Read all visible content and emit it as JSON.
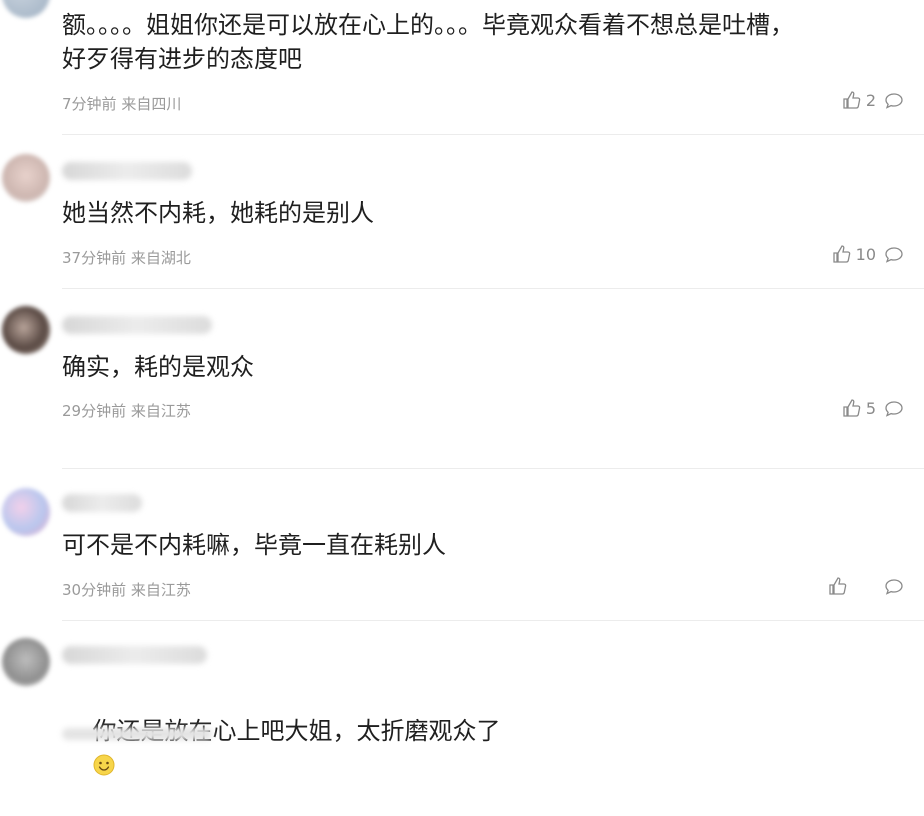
{
  "comments": [
    {
      "text": "额。。。。姐姐你还是可以放在心上的。。。毕竟观众看着不想总是吐槽，\n好歹得有进步的态度吧",
      "time": "7分钟前",
      "location": "来自四川",
      "likes": "2"
    },
    {
      "text": "她当然不内耗，她耗的是别人",
      "time": "37分钟前",
      "location": "来自湖北",
      "likes": "10"
    },
    {
      "text": "确实，耗的是观众",
      "time": "29分钟前",
      "location": "来自江苏",
      "likes": "5"
    },
    {
      "text": "可不是不内耗嘛，毕竟一直在耗别人",
      "time": "30分钟前",
      "location": "来自江苏",
      "likes": ""
    },
    {
      "text": "你还是放在心上吧大姐，太折磨观众了",
      "time": "",
      "location": "",
      "likes": ""
    }
  ],
  "icons": {
    "like": "thumbs-up-icon",
    "reply": "comment-bubble-icon",
    "emoji": "smile-emoji-icon"
  }
}
